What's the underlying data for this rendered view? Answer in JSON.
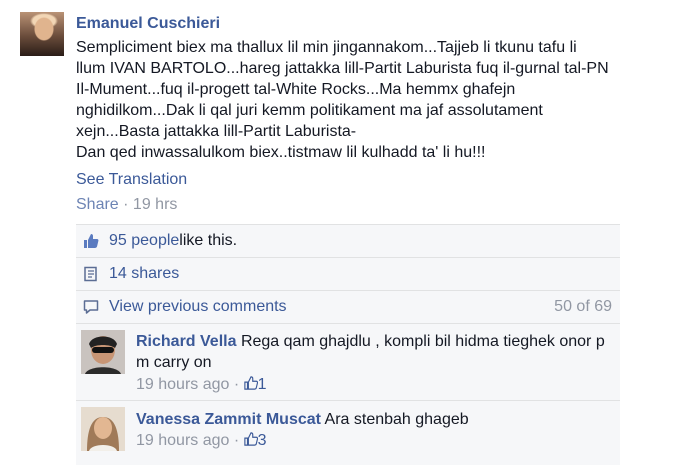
{
  "post": {
    "author": "Emanuel Cuschieri",
    "text": "Sempliciment biex ma thallux lil min jingannakom...Tajjeb li tkunu tafu li\nllum IVAN BARTOLO...hareg jattakka lill-Partit Laburista fuq il-gurnal tal-PN\nIl-Mument...fuq il-progett tal-White Rocks...Ma hemmx ghafejn\nnghidilkom...Dak li qal juri kemm politikament ma jaf assolutament\nxejn...Basta jattakka lill-Partit Laburista-\nDan qed inwassalulkom biex..tistmaw lil kulhadd ta' li hu!!!",
    "see_translation": "See Translation",
    "share_label": "Share",
    "separator": " · ",
    "time": "19 hrs"
  },
  "ufi": {
    "likes_link": "95 people",
    "likes_suffix": " like this.",
    "shares": "14 shares",
    "view_previous": "View previous comments",
    "comment_count": "50 of 69"
  },
  "comments": [
    {
      "name": "Richard Vella",
      "text": "Rega qam ghajdlu , kompli bil hidma tieghek onor p m carry on",
      "time": "19 hours ago",
      "separator": " · ",
      "likes": "1"
    },
    {
      "name": "Vanessa Zammit Muscat",
      "text": "Ara stenbah ghageb",
      "time": "19 hours ago",
      "separator": " · ",
      "likes": "3"
    }
  ],
  "colors": {
    "link": "#3b5998",
    "muted": "#9197a3",
    "ufi_bg": "#f6f7f9"
  },
  "icons": [
    "thumbs-up-icon",
    "share-icon",
    "comment-icon"
  ]
}
